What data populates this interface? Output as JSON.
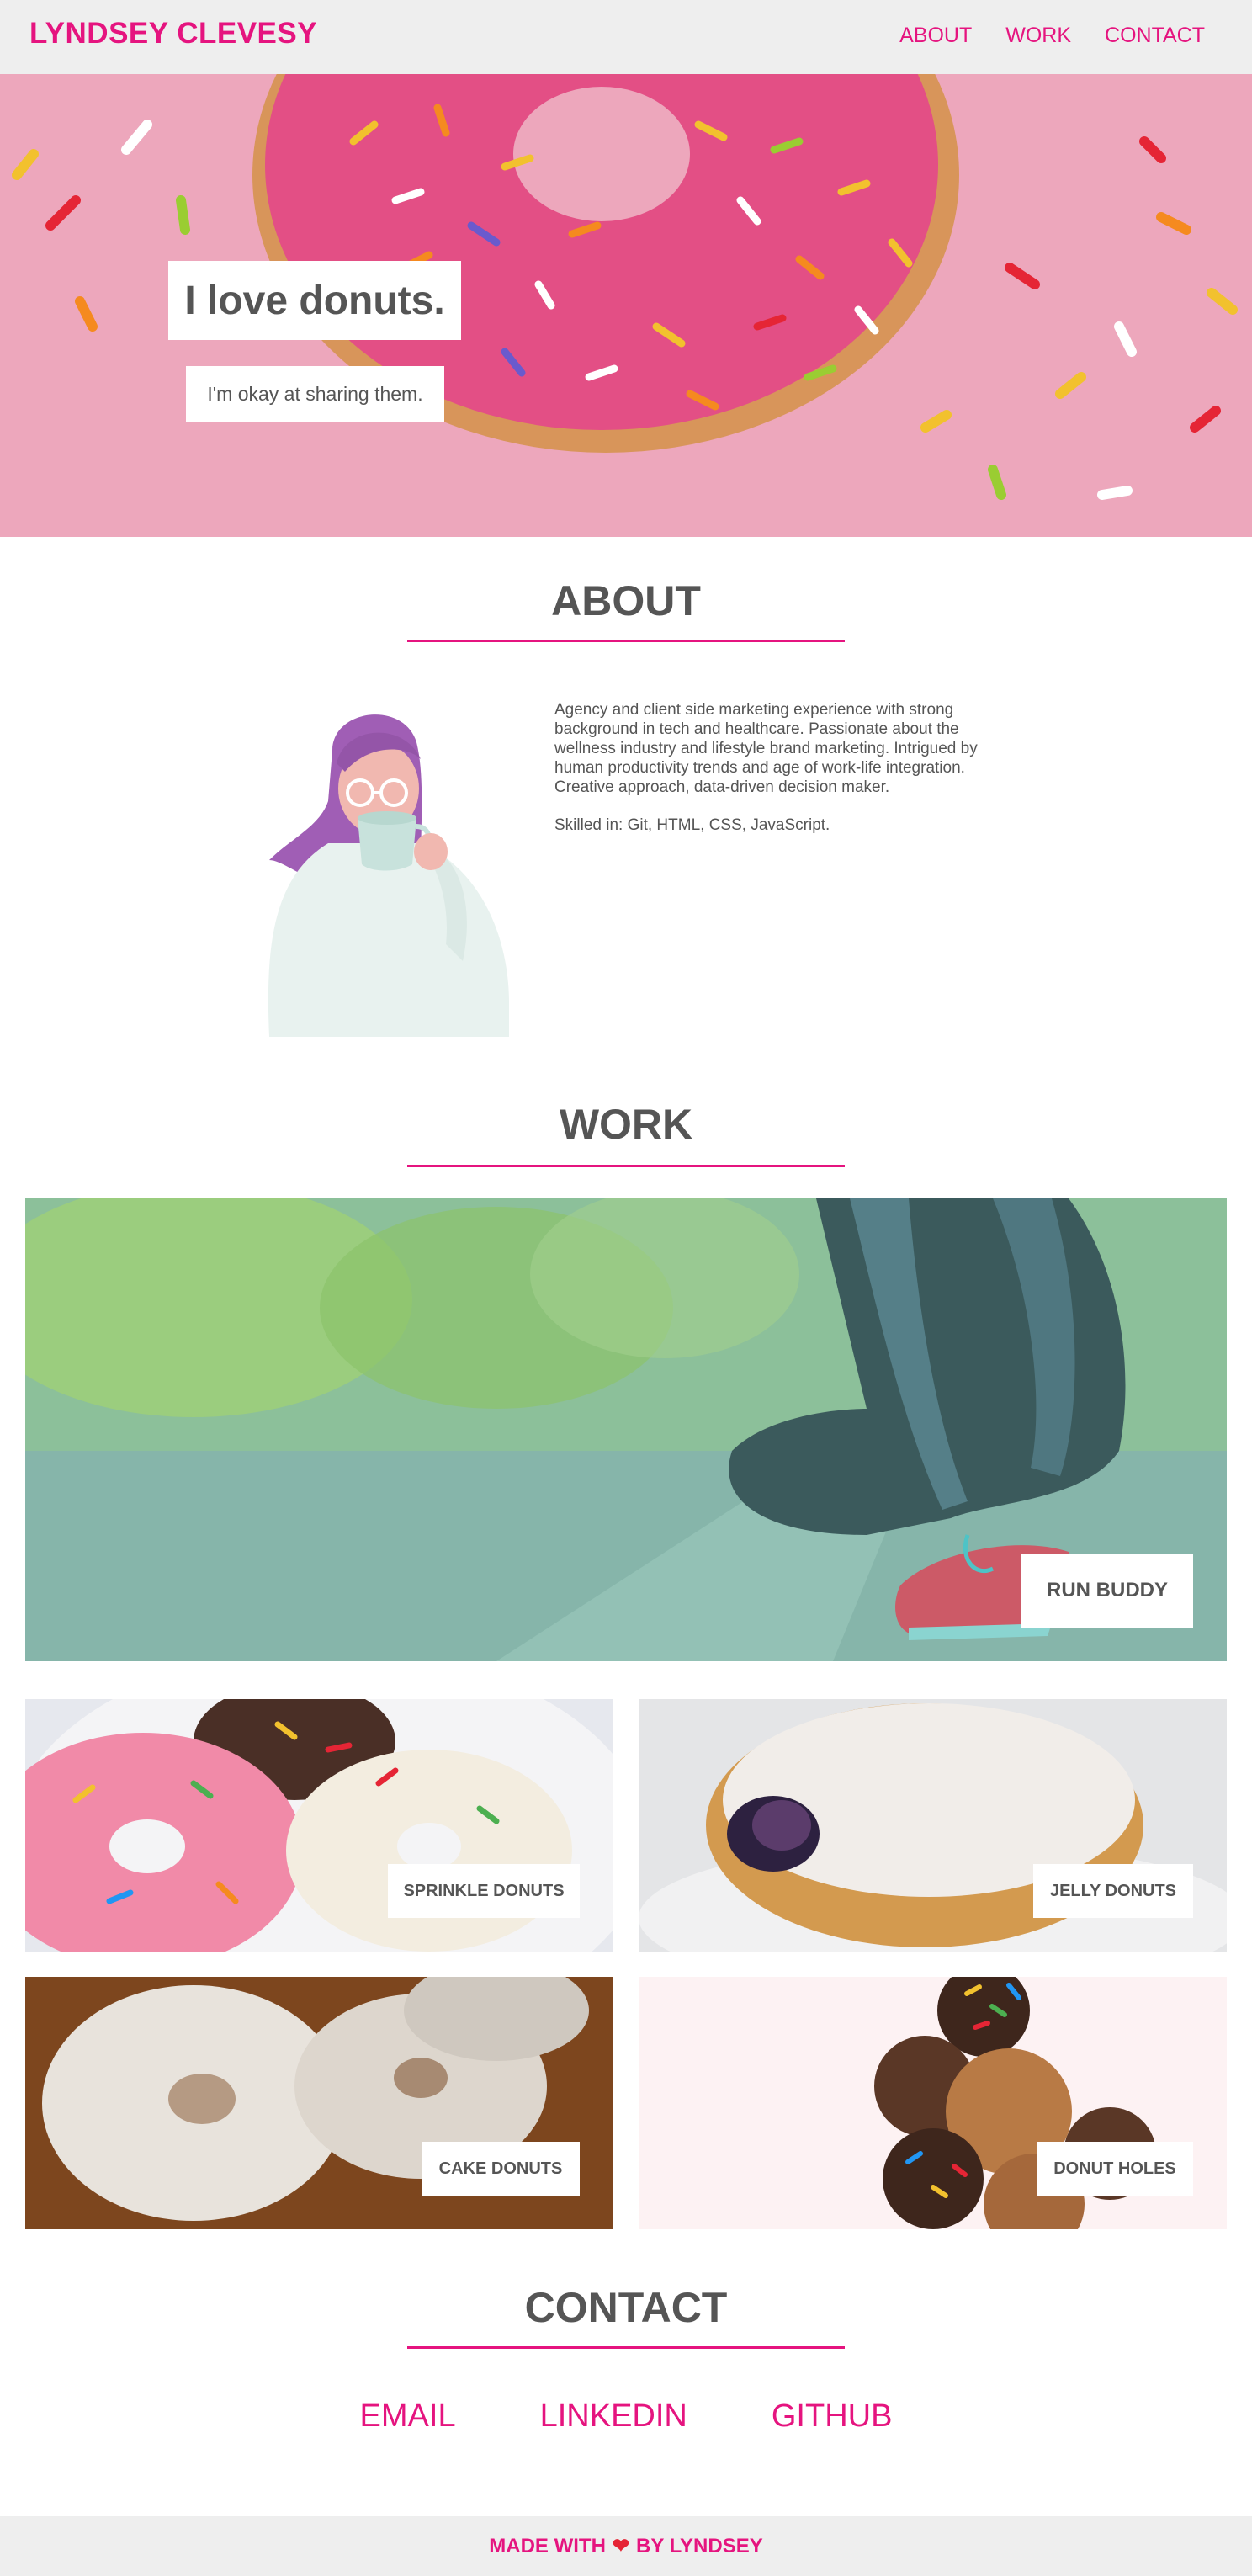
{
  "nav": {
    "brand": "LYNDSEY CLEVESY",
    "links": [
      "ABOUT",
      "WORK",
      "CONTACT"
    ]
  },
  "hero": {
    "title": "I love donuts.",
    "subtitle": "I'm okay at sharing them."
  },
  "about": {
    "heading": "ABOUT",
    "paragraph1": "Agency and client side marketing experience with strong background in tech and healthcare. Passionate about the wellness industry and lifestyle brand marketing. Intrigued by human productivity trends and age of work-life integration. Creative approach, data-driven decision maker.",
    "paragraph2": "Skilled in: Git, HTML, CSS, JavaScript."
  },
  "work": {
    "heading": "WORK",
    "featured": "RUN BUDDY",
    "projects": [
      "SPRINKLE DONUTS",
      "JELLY DONUTS",
      "CAKE DONUTS",
      "DONUT HOLES"
    ]
  },
  "contact": {
    "heading": "CONTACT",
    "links": [
      "EMAIL",
      "LINKEDIN",
      "GITHUB"
    ]
  },
  "footer": {
    "before": "MADE WITH",
    "heart": "❤",
    "after": "BY LYNDSEY"
  },
  "colors": {
    "accent": "#e5147f",
    "text": "#555555",
    "nav_bg": "#eeeeee"
  }
}
